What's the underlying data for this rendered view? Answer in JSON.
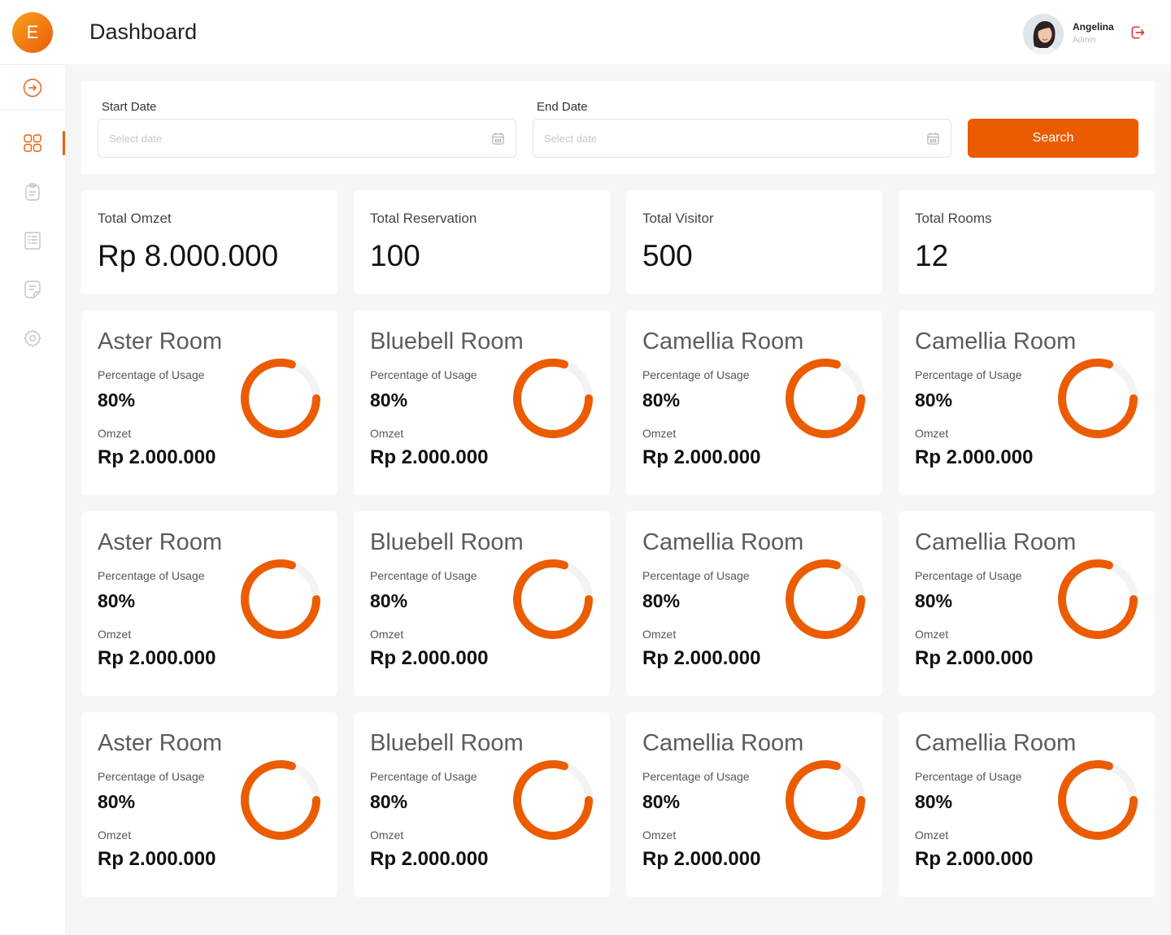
{
  "app": {
    "logo_letter": "E"
  },
  "header": {
    "title": "Dashboard",
    "user": {
      "name": "Angelina",
      "role": "Admin"
    }
  },
  "sidebar": {
    "items": [
      {
        "icon": "expand-arrow-icon"
      },
      {
        "icon": "dashboard-grid-icon",
        "active": true
      },
      {
        "icon": "clipboard-icon"
      },
      {
        "icon": "report-list-icon"
      },
      {
        "icon": "document-icon"
      },
      {
        "icon": "settings-gear-icon"
      }
    ]
  },
  "filter": {
    "start_label": "Start Date",
    "start_placeholder": "Select date",
    "end_label": "End Date",
    "end_placeholder": "Select date",
    "search_label": "Search"
  },
  "stats": [
    {
      "label": "Total Omzet",
      "value": "Rp 8.000.000"
    },
    {
      "label": "Total Reservation",
      "value": "100"
    },
    {
      "label": "Total Visitor",
      "value": "500"
    },
    {
      "label": "Total Rooms",
      "value": "12"
    }
  ],
  "room_labels": {
    "usage": "Percentage of Usage",
    "omzet": "Omzet"
  },
  "rooms": [
    {
      "name": "Aster Room",
      "usage": "80%",
      "omzet": "Rp 2.000.000",
      "usage_fraction": 0.8
    },
    {
      "name": "Bluebell Room",
      "usage": "80%",
      "omzet": "Rp 2.000.000",
      "usage_fraction": 0.8
    },
    {
      "name": "Camellia Room",
      "usage": "80%",
      "omzet": "Rp 2.000.000",
      "usage_fraction": 0.8
    },
    {
      "name": "Camellia Room",
      "usage": "80%",
      "omzet": "Rp 2.000.000",
      "usage_fraction": 0.8
    },
    {
      "name": "Aster Room",
      "usage": "80%",
      "omzet": "Rp 2.000.000",
      "usage_fraction": 0.8
    },
    {
      "name": "Bluebell Room",
      "usage": "80%",
      "omzet": "Rp 2.000.000",
      "usage_fraction": 0.8
    },
    {
      "name": "Camellia Room",
      "usage": "80%",
      "omzet": "Rp 2.000.000",
      "usage_fraction": 0.8
    },
    {
      "name": "Camellia Room",
      "usage": "80%",
      "omzet": "Rp 2.000.000",
      "usage_fraction": 0.8
    },
    {
      "name": "Aster Room",
      "usage": "80%",
      "omzet": "Rp 2.000.000",
      "usage_fraction": 0.8
    },
    {
      "name": "Bluebell Room",
      "usage": "80%",
      "omzet": "Rp 2.000.000",
      "usage_fraction": 0.8
    },
    {
      "name": "Camellia Room",
      "usage": "80%",
      "omzet": "Rp 2.000.000",
      "usage_fraction": 0.8
    },
    {
      "name": "Camellia Room",
      "usage": "80%",
      "omzet": "Rp 2.000.000",
      "usage_fraction": 0.8
    }
  ],
  "colors": {
    "accent": "#eb5c00",
    "track": "#f3f3f3",
    "logo_gradient_start": "#f7a11a",
    "logo_gradient_end": "#eb5c0b"
  }
}
